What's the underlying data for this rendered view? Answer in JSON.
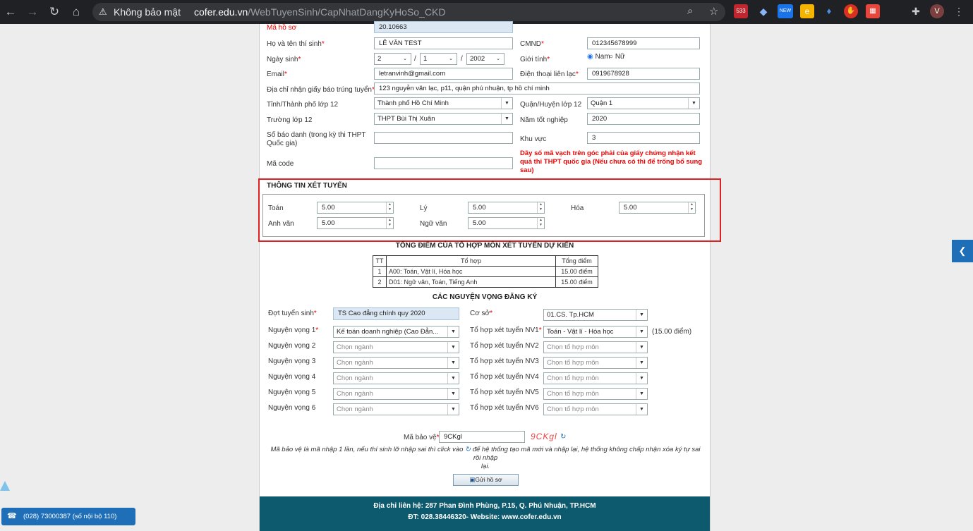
{
  "browser": {
    "security_label": "Không bảo mật",
    "url_domain": "cofer.edu.vn",
    "url_path": "/WebTuyenSinh/CapNhatDangKyHoSo_CKD",
    "mail_badge": "533",
    "new_badge": "NEW",
    "profile_letter": "V"
  },
  "form": {
    "ma_ho_so_label": "Mã hồ sơ",
    "ma_ho_so_value": "20.10663",
    "ho_ten_label": "Họ và tên thí sinh",
    "ho_ten_value": "LÊ VĂN TEST",
    "cmnd_label": "CMND",
    "cmnd_value": "012345678999",
    "ngay_sinh_label": "Ngày sinh",
    "ngay": "2",
    "thang": "1",
    "nam": "2002",
    "date_sep": "/",
    "gioi_tinh_label": "Giới tính",
    "gioi_tinh_nam": "Nam",
    "gioi_tinh_nu": "Nữ",
    "email_label": "Email",
    "email_value": "letranvinh@gmail.com",
    "dien_thoai_label": "Điện thoại liên lạc",
    "dien_thoai_value": "0919678928",
    "dia_chi_label": "Địa chỉ nhận giấy báo trúng tuyển",
    "dia_chi_value": "123 nguyễn văn lạc, p11, quận phú nhuận, tp hồ chí minh",
    "tinh_label": "Tỉnh/Thành phố lớp 12",
    "tinh_value": "Thành phố Hồ Chí Minh",
    "quan_label": "Quận/Huyện lớp 12",
    "quan_value": "Quận 1",
    "truong_label": "Trường lớp 12",
    "truong_value": "THPT Bùi Thị Xuân",
    "nam_tn_label": "Năm tốt nghiệp",
    "nam_tn_value": "2020",
    "sbd_label_1": "Số báo danh (trong kỳ thi THPT",
    "sbd_label_2": "Quốc gia)",
    "khu_vuc_label": "Khu vực",
    "khu_vuc_value": "3",
    "ma_code_label": "Mã code",
    "note": "Dãy số mã vạch trên góc phải của giấy chứng nhận kết quả thi THPT quốc gia (Nếu chưa có thì để trống bổ sung sau)"
  },
  "xet_tuyen": {
    "title": "THÔNG TIN XÉT TUYỂN",
    "toan_label": "Toán",
    "toan": "5.00",
    "ly_label": "Lý",
    "ly": "5.00",
    "hoa_label": "Hóa",
    "hoa": "5.00",
    "anh_label": "Anh văn",
    "anh": "5.00",
    "van_label": "Ngữ văn",
    "van": "5.00"
  },
  "tong_diem": {
    "title": "TỔNG ĐIỂM CỦA TỔ HỢP MÔN XÉT TUYỂN DỰ KIẾN",
    "headers": [
      "TT",
      "Tổ hợp",
      "Tổng điểm"
    ],
    "rows": [
      [
        "1",
        "A00: Toán, Vật lí, Hóa học",
        "15.00 điểm"
      ],
      [
        "2",
        "D01: Ngữ văn, Toán, Tiếng Anh",
        "15.00 điểm"
      ]
    ]
  },
  "nguyen_vong": {
    "title": "CÁC NGUYỆN VỌNG ĐĂNG KÝ",
    "dot_label": "Đợt tuyển sinh",
    "dot_value": "TS Cao đẳng chính quy 2020",
    "co_so_label": "Cơ sở",
    "co_so_value": "01.CS. Tp.HCM",
    "nv_labels": [
      "Nguyện vọng 1",
      "Nguyện vọng 2",
      "Nguyện vọng 3",
      "Nguyện vọng 4",
      "Nguyện vọng 5",
      "Nguyện vọng 6"
    ],
    "nv_values": [
      "Kế toán doanh nghiệp (Cao Đẳn...",
      "Chọn ngành",
      "Chọn ngành",
      "Chọn ngành",
      "Chọn ngành",
      "Chọn ngành"
    ],
    "th_labels": [
      "Tổ hợp xét tuyển NV1",
      "Tổ hợp xét tuyển NV2",
      "Tổ hợp xét tuyển NV3",
      "Tổ hợp xét tuyển NV4",
      "Tổ hợp xét tuyển NV5",
      "Tổ hợp xét tuyển NV6"
    ],
    "th_values": [
      "Toán - Vật lí - Hóa học",
      "Chọn tổ hợp môn",
      "Chọn tổ hợp môn",
      "Chọn tổ hợp môn",
      "Chọn tổ hợp môn",
      "Chọn tổ hợp môn"
    ],
    "nv1_score": "(15.00 điểm)"
  },
  "captcha": {
    "label": "Mã bảo vệ",
    "value": "9CKgl",
    "image_text": "9CKgl",
    "hint_1": "Mã bảo vệ là mã nhập 1 lần, nếu thí sinh lỡ nhập sai thì click vào",
    "hint_2": "để hệ thống tạo mã mới và nhập lại, hệ thống không chấp nhận xóa ký tự sai rồi nhập",
    "hint_3": "lại."
  },
  "submit_label": "Gửi hồ sơ",
  "footer": {
    "line1": "Địa chỉ liên hệ: 287 Phan Đình Phùng, P.15, Q. Phú Nhuận, TP.HCM",
    "line2": "ĐT: 028.38446320- Website: www.cofer.edu.vn"
  },
  "hotline": "(028) 73000387 (số nội bộ 110)"
}
